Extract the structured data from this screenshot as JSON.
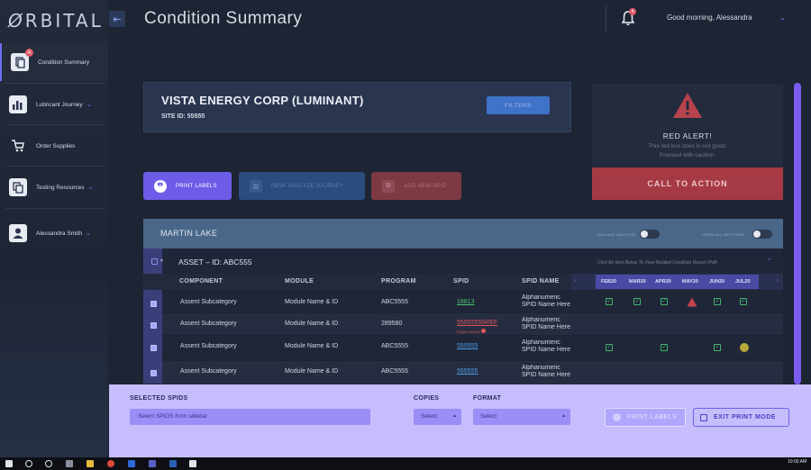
{
  "app": {
    "logo": "RBITAL",
    "page_title": "Condition Summary",
    "greeting": "Good morning, Alessandra",
    "notification_count": "4"
  },
  "sidebar": {
    "items": [
      {
        "label": "Condition Summary",
        "icon": "document-icon",
        "badge": "A",
        "active": true
      },
      {
        "label": "Lubricant Journey",
        "icon": "bar-chart-icon",
        "chevron": true
      },
      {
        "label": "Order Supplies",
        "icon": "cart-icon"
      },
      {
        "label": "Testing Resources",
        "icon": "copy-icon",
        "chevron": true
      },
      {
        "label": "Alessandra Smith",
        "icon": "user-icon",
        "chevron": true
      }
    ]
  },
  "company": {
    "name": "VISTA ENERGY CORP (LUMINANT)",
    "site_id": "SITE ID: 55555",
    "filters_label": "FILTERS"
  },
  "alert": {
    "title": "RED ALERT!",
    "line1": "This red box does is not good.",
    "line2": "Proceed with caution.",
    "cta": "CALL TO ACTION"
  },
  "actions": {
    "print_labels": "PRINT LABELS",
    "analyze": "NEW! ANALYZE JOURNEY",
    "add_spid": "ADD NEW SPID"
  },
  "table": {
    "group_title": "MARTIN LAKE",
    "toggle1_label": "INCLUDE INACTIVE",
    "toggle2_label": "OPEN ALL SECTIONS",
    "asset_title": "ASSET – ID: ABC555",
    "click_note": "Click An Item Below To View Related Condition Report (Pdf)",
    "columns": [
      "COMPONENT",
      "MODULE",
      "PROGRAM",
      "SPID",
      "SPID NAME"
    ],
    "months": [
      "FEB20",
      "MAR20",
      "APR20",
      "MAY20",
      "JUN20",
      "JUL20"
    ],
    "rows": [
      {
        "component": "Assent Subcategory",
        "module": "Module Name & ID",
        "program": "ABC5555",
        "spid": "18813",
        "spid_style": "green",
        "spid_name1": "Alphanumeric",
        "spid_name2": "SPID Name Here",
        "marks": [
          "ok",
          "ok",
          "ok",
          "alert",
          "ok",
          "ok"
        ]
      },
      {
        "component": "Assent Subcategory",
        "module": "Module Name & ID",
        "program": "289580",
        "spid": "55555555REF",
        "spid_style": "red",
        "expired": "Expired 9/4/20",
        "spid_name1": "Alphanumeric",
        "spid_name2": "SPID Name Here",
        "marks": [
          "",
          "",
          "",
          "",
          "",
          ""
        ]
      },
      {
        "component": "Assent Subcategory",
        "module": "Module Name & ID",
        "program": "ABC5555",
        "spid": "555555",
        "spid_style": "blue",
        "spid_name1": "Alphanumeric",
        "spid_name2": "SPID Name Here",
        "marks": [
          "ok",
          "",
          "ok",
          "",
          "ok",
          "warn"
        ]
      },
      {
        "component": "Assent Subcategory",
        "module": "Module Name & ID",
        "program": "ABC5555",
        "spid": "555555",
        "spid_style": "blue",
        "spid_name1": "Alphanumeric",
        "spid_name2": "SPID Name Here",
        "marks": [
          "",
          "",
          "",
          "",
          "",
          ""
        ]
      }
    ]
  },
  "print_panel": {
    "selected_label": "SELECTED SPIDS",
    "selected_placeholder": "Select SPIDS from sidebar",
    "copies_label": "COPIES",
    "copies_value": "Select",
    "format_label": "FORMAT",
    "format_value": "Select",
    "print_button": "PRINT LABELS",
    "exit_button": "EXIT PRINT MODE"
  },
  "taskbar": {
    "time": "10:00 AM"
  },
  "colors": {
    "accent": "#6c5ce8",
    "alert": "#a53a44",
    "ok": "#44b36a",
    "print_panel": "#c6bdfc"
  }
}
